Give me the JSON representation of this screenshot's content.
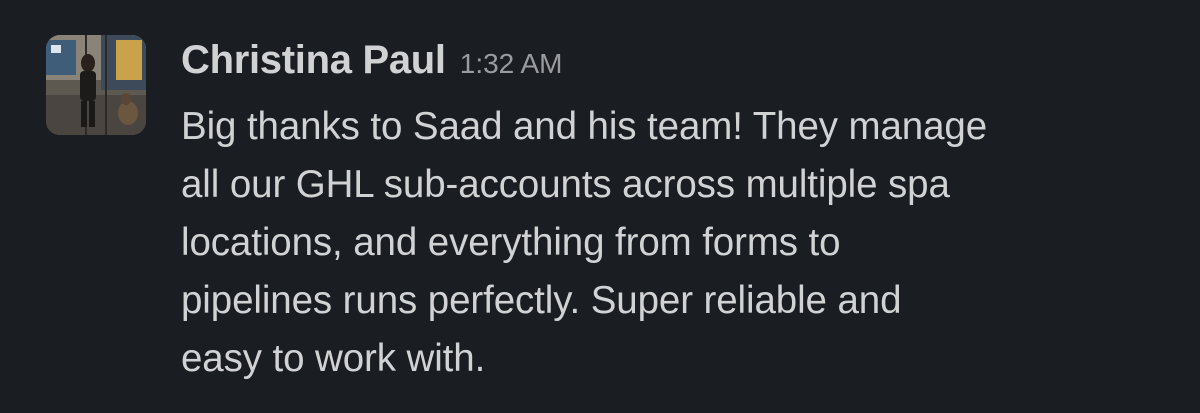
{
  "message": {
    "sender": "Christina Paul",
    "timestamp": "1:32 AM",
    "avatar_icon": "user-photo-avatar",
    "lines": [
      "Big thanks to Saad and his team! They manage",
      "all our GHL sub-accounts across multiple spa",
      "locations, and everything from forms to",
      "pipelines runs perfectly. Super reliable and",
      "easy to work with."
    ]
  },
  "colors": {
    "background": "#1a1d21",
    "text": "#d1d2d3",
    "timestamp": "#9a9b9d"
  }
}
